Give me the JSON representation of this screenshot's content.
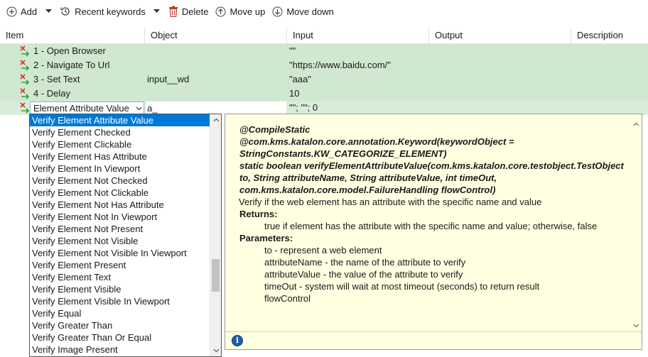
{
  "toolbar": {
    "add_label": "Add",
    "recent_label": "Recent keywords",
    "delete_label": "Delete",
    "move_up_label": "Move up",
    "move_down_label": "Move down"
  },
  "table": {
    "columns": [
      "Item",
      "Object",
      "Input",
      "Output",
      "Description"
    ],
    "rows": [
      {
        "item": "1 - Open Browser",
        "object": "",
        "input": "\"\"",
        "output": "",
        "description": ""
      },
      {
        "item": "2 - Navigate To Url",
        "object": "",
        "input": "\"https://www.baidu.com/\"",
        "output": "",
        "description": ""
      },
      {
        "item": "3 - Set Text",
        "object": "input__wd",
        "input": "\"aaa\"",
        "output": "",
        "description": ""
      },
      {
        "item": "4 - Delay",
        "object": "",
        "input": "10",
        "output": "",
        "description": ""
      }
    ],
    "editing_row": {
      "keyword_value": "Element Attribute Value",
      "object_value": "a_",
      "input": "\"\"; \"\"; 0"
    }
  },
  "dropdown": {
    "selected_index": 0,
    "items": [
      "Verify Element Attribute Value",
      "Verify Element Checked",
      "Verify Element Clickable",
      "Verify Element Has Attribute",
      "Verify Element In Viewport",
      "Verify Element Not Checked",
      "Verify Element Not Clickable",
      "Verify Element Not Has Attribute",
      "Verify Element Not In Viewport",
      "Verify Element Not Present",
      "Verify Element Not Visible",
      "Verify Element Not Visible In Viewport",
      "Verify Element Present",
      "Verify Element Text",
      "Verify Element Visible",
      "Verify Element Visible In Viewport",
      "Verify Equal",
      "Verify Greater Than",
      "Verify Greater Than Or Equal",
      "Verify Image Present"
    ]
  },
  "doc": {
    "sig_lines": [
      "@CompileStatic",
      "@com.kms.katalon.core.annotation.Keyword(keywordObject = StringConstants.KW_CATEGORIZE_ELEMENT)",
      "static boolean verifyElementAttributeValue(com.kms.katalon.core.testobject.TestObject to, String attributeName, String attributeValue, int timeOut, com.kms.katalon.core.model.FailureHandling flowControl)"
    ],
    "summary": "Verify if the web element has an attribute with the specific name and value",
    "returns_label": "Returns:",
    "returns_text": "true if element has the attribute with the specific name and value; otherwise, false",
    "params_label": "Parameters:",
    "params": [
      "to - represent a web element",
      "attributeName - the name of the attribute to verify",
      "attributeValue - the value of the attribute to verify",
      "timeOut - system will wait at most timeout (seconds) to return result",
      "flowControl"
    ]
  },
  "colors": {
    "row_bg": "#cfe8cf",
    "selection": "#0078d7",
    "doc_bg": "#ffffe1",
    "delete_icon": "#c0392b",
    "step_icon_red": "#d9302b",
    "step_icon_green": "#2e9e3e"
  },
  "icons": {
    "add": "plus-circle-icon",
    "recent": "history-icon",
    "delete": "trash-icon",
    "move_up": "arrow-up-circle-icon",
    "move_down": "arrow-down-circle-icon",
    "step": "step-x-arrow-icon",
    "info": "info-icon"
  }
}
